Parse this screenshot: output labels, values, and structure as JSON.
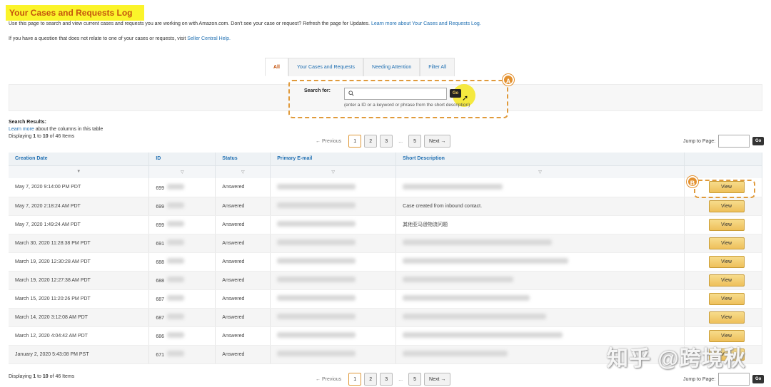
{
  "header": {
    "title": "Your Cases and Requests Log",
    "intro_text": "Use this page to search and view current cases and requests you are working on with Amazon.com. Don't see your case or request? Refresh the page for Updates.",
    "intro_link": "Learn more about Your Cases and Requests Log.",
    "help_text": "If you have a question that does not relate to one of your cases or requests, visit",
    "help_link": "Seller Central Help."
  },
  "tabs": [
    {
      "label": "All",
      "active": true
    },
    {
      "label": "Your Cases and Requests",
      "active": false
    },
    {
      "label": "Needing Attention",
      "active": false
    },
    {
      "label": "Filter All",
      "active": false
    }
  ],
  "search": {
    "label": "Search for:",
    "value": "",
    "go_label": "Go",
    "hint": "(enter a ID or a keyword or phrase from the short description)",
    "marker": "A"
  },
  "results": {
    "heading": "Search Results:",
    "learn_more_link": "Learn more",
    "learn_more_text": "about the columns in this table",
    "displaying_prefix": "Displaying",
    "from": "1",
    "to_word": "to",
    "to": "10",
    "of_text": "of 46 Items"
  },
  "pagination": {
    "previous": "← Previous",
    "pages": [
      "1",
      "2",
      "3"
    ],
    "ellipsis": "...",
    "last_page": "5",
    "next": "Next →",
    "jump_label": "Jump to Page:",
    "jump_go": "Go"
  },
  "table": {
    "columns": [
      "Creation Date",
      "ID",
      "Status",
      "Primary E-mail",
      "Short Description"
    ],
    "view_label": "View",
    "view_marker": "B",
    "rows": [
      {
        "date": "May 7, 2020 9:14:00 PM PDT",
        "id": "699",
        "status": "Answered",
        "desc": ""
      },
      {
        "date": "May 7, 2020 2:18:24 AM PDT",
        "id": "699",
        "status": "Answered",
        "desc": "Case created from inbound contact."
      },
      {
        "date": "May 7, 2020 1:49:24 AM PDT",
        "id": "699",
        "status": "Answered",
        "desc": "其他亚马逊物流问题"
      },
      {
        "date": "March 30, 2020 11:28:38 PM PDT",
        "id": "691",
        "status": "Answered",
        "desc": ""
      },
      {
        "date": "March 19, 2020 12:30:28 AM PDT",
        "id": "688",
        "status": "Answered",
        "desc": ""
      },
      {
        "date": "March 19, 2020 12:27:38 AM PDT",
        "id": "688",
        "status": "Answered",
        "desc": ""
      },
      {
        "date": "March 15, 2020 11:20:26 PM PDT",
        "id": "687",
        "status": "Answered",
        "desc": ""
      },
      {
        "date": "March 14, 2020 3:12:08 AM PDT",
        "id": "687",
        "status": "Answered",
        "desc": ""
      },
      {
        "date": "March 12, 2020 4:04:42 AM PDT",
        "id": "686",
        "status": "Answered",
        "desc": ""
      },
      {
        "date": "January 2, 2020 5:43:08 PM PST",
        "id": "671",
        "status": "Answered",
        "desc": ""
      }
    ]
  },
  "footer": {
    "displaying_prefix": "Displaying",
    "from": "1",
    "to_word": "to",
    "to": "10",
    "of_text": "of 46 Items"
  },
  "watermark": "知乎 @跨境秋"
}
